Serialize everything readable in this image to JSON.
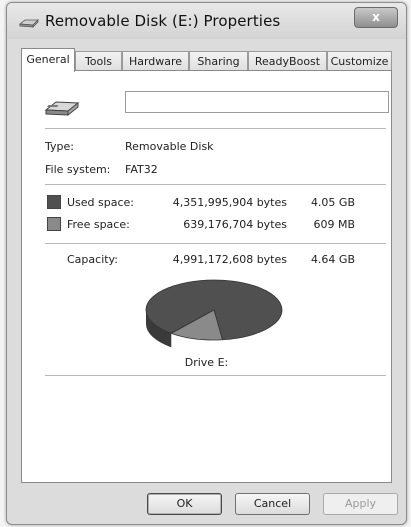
{
  "window": {
    "title": "Removable Disk (E:) Properties",
    "close_glyph": "x"
  },
  "tabs": [
    {
      "label": "General",
      "active": true
    },
    {
      "label": "Tools",
      "active": false
    },
    {
      "label": "Hardware",
      "active": false
    },
    {
      "label": "Sharing",
      "active": false
    },
    {
      "label": "ReadyBoost",
      "active": false
    },
    {
      "label": "Customize",
      "active": false
    }
  ],
  "general": {
    "drive_name_value": "",
    "type_label": "Type:",
    "type_value": "Removable Disk",
    "fs_label": "File system:",
    "fs_value": "FAT32",
    "used": {
      "label": "Used space:",
      "bytes": "4,351,995,904 bytes",
      "size": "4.05 GB",
      "color": "#505050"
    },
    "free": {
      "label": "Free space:",
      "bytes": "639,176,704 bytes",
      "size": "609 MB",
      "color": "#8a8a8a"
    },
    "capacity": {
      "label": "Capacity:",
      "bytes": "4,991,172,608 bytes",
      "size": "4.64 GB"
    },
    "drive_label": "Drive E:",
    "used_fraction": 0.872
  },
  "buttons": {
    "ok": "OK",
    "cancel": "Cancel",
    "apply": "Apply"
  }
}
